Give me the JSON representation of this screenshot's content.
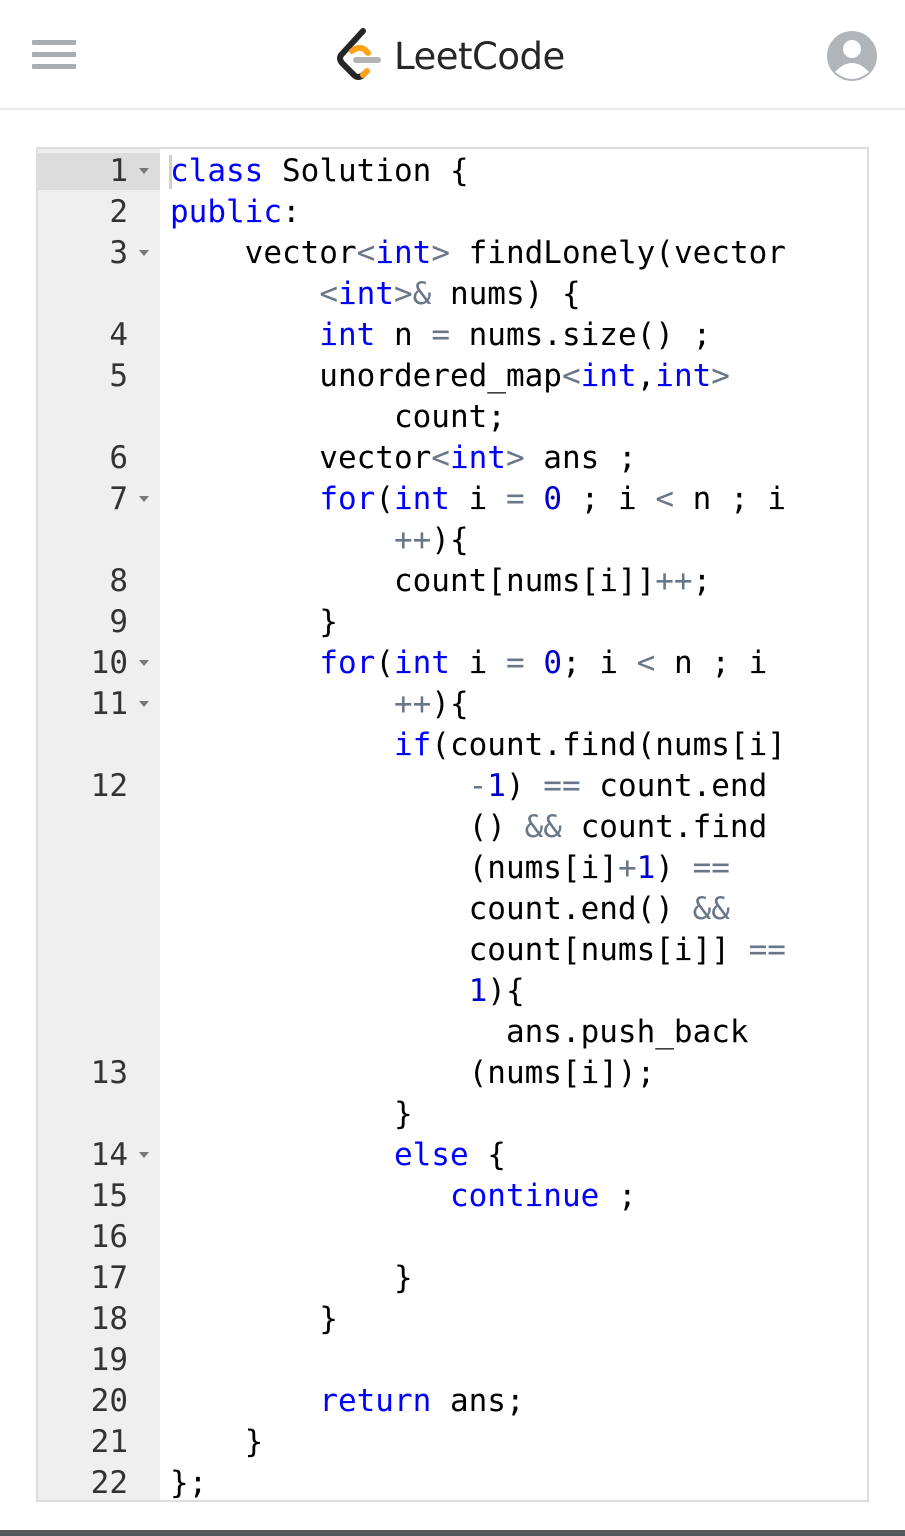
{
  "header": {
    "brand_name": "LeetCode",
    "menu_icon": "hamburger-menu-icon",
    "logo_icon": "leetcode-logo-icon",
    "account_icon": "user-avatar-icon",
    "brand_colors": {
      "dark": "#262626",
      "orange": "#ffa116",
      "gray": "#b3b3b3"
    }
  },
  "editor": {
    "line_numbers": [
      "1",
      "2",
      "3",
      "4",
      "5",
      "6",
      "7",
      "8",
      "9",
      "10",
      "11",
      "12",
      "13",
      "14",
      "15",
      "16",
      "17",
      "18",
      "19",
      "20",
      "21",
      "22"
    ],
    "fold_lines": [
      "1",
      "3",
      "7",
      "10",
      "11",
      "14"
    ],
    "visual_lines": [
      [
        [
          "kw",
          "class"
        ],
        [
          "t",
          " Solution {"
        ]
      ],
      [
        [
          "kw",
          "public"
        ],
        [
          "t",
          ":"
        ]
      ],
      [
        [
          "t",
          "    vector"
        ],
        [
          "op",
          "<"
        ],
        [
          "kw",
          "int"
        ],
        [
          "op",
          ">"
        ],
        [
          "t",
          " findLonely(vector"
        ]
      ],
      [
        [
          "t",
          "        "
        ],
        [
          "op",
          "<"
        ],
        [
          "kw",
          "int"
        ],
        [
          "op",
          ">&"
        ],
        [
          "t",
          " nums) {"
        ]
      ],
      [
        [
          "t",
          "        "
        ],
        [
          "kw",
          "int"
        ],
        [
          "t",
          " n "
        ],
        [
          "op",
          "="
        ],
        [
          "t",
          " nums.size() ;"
        ]
      ],
      [
        [
          "t",
          "        unordered_map"
        ],
        [
          "op",
          "<"
        ],
        [
          "kw",
          "int"
        ],
        [
          "t",
          ","
        ],
        [
          "kw",
          "int"
        ],
        [
          "op",
          ">"
        ]
      ],
      [
        [
          "t",
          "            count;"
        ]
      ],
      [
        [
          "t",
          "        vector"
        ],
        [
          "op",
          "<"
        ],
        [
          "kw",
          "int"
        ],
        [
          "op",
          ">"
        ],
        [
          "t",
          " ans ;"
        ]
      ],
      [
        [
          "t",
          "        "
        ],
        [
          "kw",
          "for"
        ],
        [
          "t",
          "("
        ],
        [
          "kw",
          "int"
        ],
        [
          "t",
          " i "
        ],
        [
          "op",
          "="
        ],
        [
          "t",
          " "
        ],
        [
          "num",
          "0"
        ],
        [
          "t",
          " ; i "
        ],
        [
          "op",
          "<"
        ],
        [
          "t",
          " n ; i"
        ]
      ],
      [
        [
          "t",
          "            "
        ],
        [
          "op",
          "++"
        ],
        [
          "t",
          "){"
        ]
      ],
      [
        [
          "t",
          "            count[nums[i]]"
        ],
        [
          "op",
          "++"
        ],
        [
          "t",
          ";"
        ]
      ],
      [
        [
          "t",
          "        }"
        ]
      ],
      [
        [
          "t",
          "        "
        ],
        [
          "kw",
          "for"
        ],
        [
          "t",
          "("
        ],
        [
          "kw",
          "int"
        ],
        [
          "t",
          " i "
        ],
        [
          "op",
          "="
        ],
        [
          "t",
          " "
        ],
        [
          "num",
          "0"
        ],
        [
          "t",
          "; i "
        ],
        [
          "op",
          "<"
        ],
        [
          "t",
          " n ; i"
        ]
      ],
      [
        [
          "t",
          "            "
        ],
        [
          "op",
          "++"
        ],
        [
          "t",
          "){"
        ]
      ],
      [
        [
          "t",
          "            "
        ],
        [
          "kw",
          "if"
        ],
        [
          "t",
          "(count.find(nums[i]"
        ]
      ],
      [
        [
          "t",
          "                "
        ],
        [
          "op",
          "-"
        ],
        [
          "num",
          "1"
        ],
        [
          "t",
          ") "
        ],
        [
          "op",
          "=="
        ],
        [
          "t",
          " count.end"
        ]
      ],
      [
        [
          "t",
          "                () "
        ],
        [
          "op",
          "&&"
        ],
        [
          "t",
          " count.find"
        ]
      ],
      [
        [
          "t",
          "                (nums[i]"
        ],
        [
          "op",
          "+"
        ],
        [
          "num",
          "1"
        ],
        [
          "t",
          ") "
        ],
        [
          "op",
          "=="
        ]
      ],
      [
        [
          "t",
          "                count.end() "
        ],
        [
          "op",
          "&&"
        ]
      ],
      [
        [
          "t",
          "                count[nums[i]] "
        ],
        [
          "op",
          "=="
        ]
      ],
      [
        [
          "t",
          "                "
        ],
        [
          "num",
          "1"
        ],
        [
          "t",
          "){"
        ]
      ],
      [
        [
          "t",
          "                  ans.push_back"
        ]
      ],
      [
        [
          "t",
          "                (nums[i]);"
        ]
      ],
      [
        [
          "t",
          "            }"
        ]
      ],
      [
        [
          "t",
          "            "
        ],
        [
          "kw",
          "else"
        ],
        [
          "t",
          " {"
        ]
      ],
      [
        [
          "t",
          "               "
        ],
        [
          "kw",
          "continue"
        ],
        [
          "t",
          " ;"
        ]
      ],
      [
        [
          "t",
          ""
        ]
      ],
      [
        [
          "t",
          "            }"
        ]
      ],
      [
        [
          "t",
          "        }"
        ]
      ],
      [
        [
          "t",
          ""
        ]
      ],
      [
        [
          "t",
          "        "
        ],
        [
          "kw",
          "return"
        ],
        [
          "t",
          " ans;"
        ]
      ],
      [
        [
          "t",
          "    }"
        ]
      ],
      [
        [
          "t",
          "};"
        ]
      ]
    ]
  }
}
